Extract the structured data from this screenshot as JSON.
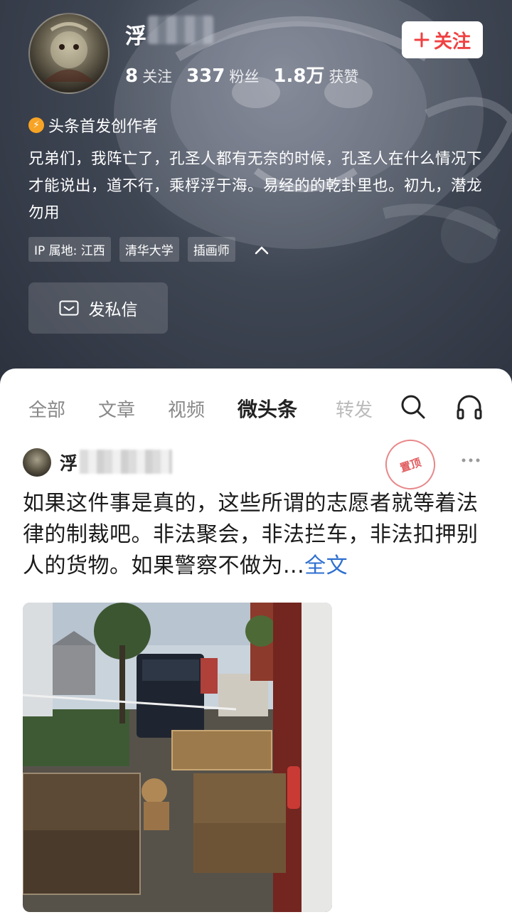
{
  "profile": {
    "username": "浮",
    "stats": [
      {
        "num": "8",
        "label": "关注"
      },
      {
        "num": "337",
        "label": "粉丝"
      },
      {
        "num": "1.8万",
        "label": "获赞"
      }
    ],
    "follow_label": "关注",
    "creator_badge": "头条首发创作者",
    "bio": "兄弟们，我阵亡了，孔圣人都有无奈的时候，孔圣人在什么情况下才能说出，道不行，乘桴浮于海。易经的的乾卦里也。初九，潜龙勿用",
    "tags": [
      "IP 属地: 江西",
      "清华大学",
      "插画师"
    ],
    "message_label": "发私信"
  },
  "tabs": [
    {
      "label": "全部",
      "active": false
    },
    {
      "label": "文章",
      "active": false
    },
    {
      "label": "视频",
      "active": false
    },
    {
      "label": "微头条",
      "active": true
    },
    {
      "label": "转发",
      "active": false
    }
  ],
  "post": {
    "author": "浮",
    "pinned_stamp": "置顶",
    "text": "如果这件事是真的，这些所谓的志愿者就等着法律的制裁吧。非法聚会，非法拦车，非法扣押别人的货物。如果警察不做为...",
    "more_label": "全文"
  },
  "icons": {
    "search": "search-icon",
    "listen": "headphones-icon",
    "more": "more-dots-icon",
    "message": "mail-icon",
    "collapse": "chevron-up-icon"
  },
  "colors": {
    "follow_text": "#f04142",
    "link": "#2f6fd0",
    "creator_badge": "#f7a325"
  }
}
